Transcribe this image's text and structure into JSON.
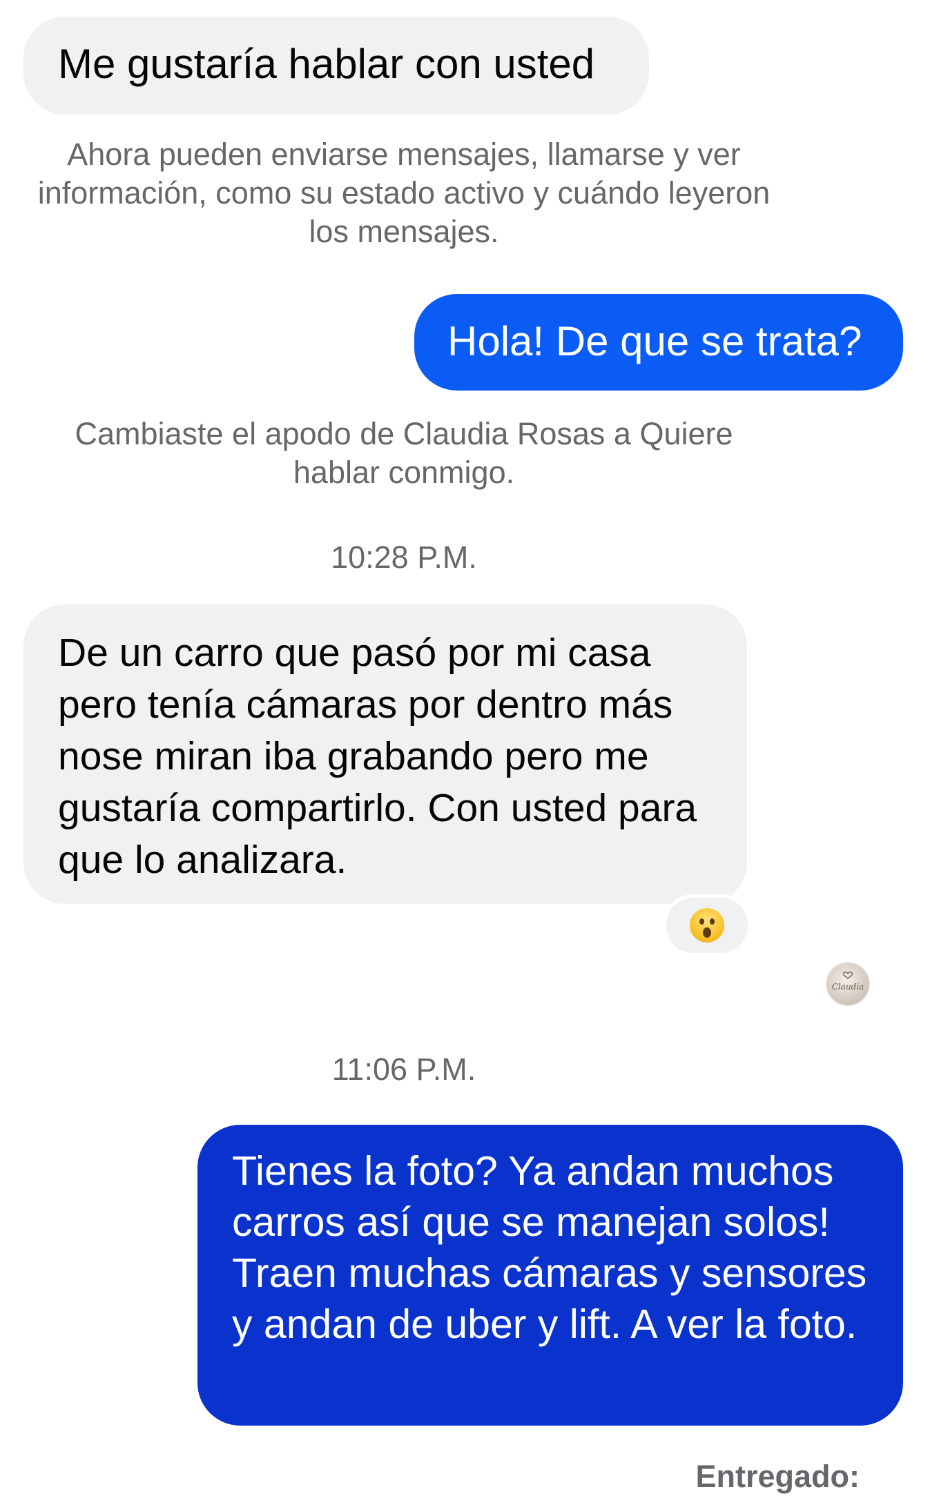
{
  "thread": {
    "messages": [
      {
        "sender": "other",
        "text": "Me gustaría hablar con usted"
      },
      {
        "sender": "me",
        "text": "Hola! De que se trata?"
      },
      {
        "sender": "other",
        "text": "De un carro que pasó por mi casa pero tenía cámaras por dentro más nose miran iba grabando pero me gustaría compartirlo. Con usted para que lo analizara."
      },
      {
        "sender": "me",
        "text": "Tienes la foto? Ya andan muchos carros así que se manejan solos! Traen muchas cámaras y sensores y andan de uber y lift. A ver la foto."
      }
    ],
    "system_notices": [
      "Ahora pueden enviarse mensajes, llamarse y ver información, como su estado activo y cuándo leyeron los mensajes.",
      "Cambiaste el apodo de Claudia Rosas a Quiere hablar conmigo."
    ],
    "timestamps": [
      "10:28 P.M.",
      "11:06 P.M."
    ],
    "reaction": {
      "icon": "wow-emoji-icon",
      "on_message": 2
    },
    "read_receipt": {
      "icon": "contact-avatar-icon",
      "avatar_text": "Claudia"
    },
    "delivery_status": "Entregado:"
  },
  "colors": {
    "incoming_bubble": "#f0f1f3",
    "outgoing_bubble_light": "#0a5cf5",
    "outgoing_bubble_dark": "#0933cc",
    "secondary_text": "#65676b"
  }
}
